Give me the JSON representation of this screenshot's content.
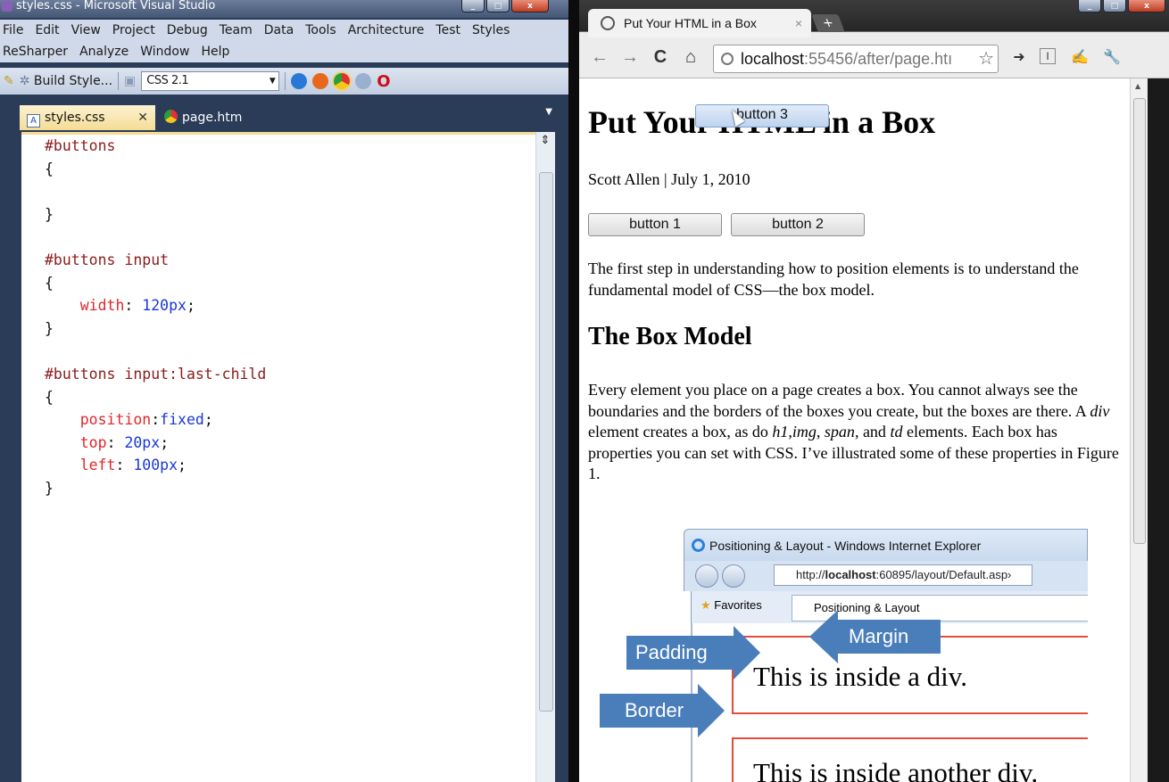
{
  "vs": {
    "title": "styles.css - Microsoft Visual Studio",
    "menu_row1": [
      "File",
      "Edit",
      "View",
      "Project",
      "Debug",
      "Team",
      "Data",
      "Tools",
      "Architecture",
      "Test",
      "Styles"
    ],
    "menu_row2": [
      "ReSharper",
      "Analyze",
      "Window",
      "Help"
    ],
    "toolbar": {
      "build_style": "Build Style...",
      "css_version": "CSS 2.1"
    },
    "tabs": [
      {
        "label": "styles.css"
      },
      {
        "label": "page.htm"
      }
    ],
    "code_lines": [
      [
        {
          "t": "#buttons",
          "c": "sel"
        }
      ],
      [
        {
          "t": "{",
          "c": ""
        }
      ],
      [],
      [
        {
          "t": "}",
          "c": ""
        }
      ],
      [],
      [
        {
          "t": "#buttons input",
          "c": "sel"
        }
      ],
      [
        {
          "t": "{",
          "c": ""
        }
      ],
      [
        {
          "t": "    ",
          "c": ""
        },
        {
          "t": "width",
          "c": "prop"
        },
        {
          "t": ": ",
          "c": ""
        },
        {
          "t": "120px",
          "c": "val"
        },
        {
          "t": ";",
          "c": ""
        }
      ],
      [
        {
          "t": "}",
          "c": ""
        }
      ],
      [],
      [
        {
          "t": "#buttons input:last-child",
          "c": "sel"
        }
      ],
      [
        {
          "t": "{",
          "c": ""
        }
      ],
      [
        {
          "t": "    ",
          "c": ""
        },
        {
          "t": "position",
          "c": "prop"
        },
        {
          "t": ":",
          "c": ""
        },
        {
          "t": "fixed",
          "c": "val"
        },
        {
          "t": ";",
          "c": ""
        }
      ],
      [
        {
          "t": "    ",
          "c": ""
        },
        {
          "t": "top",
          "c": "prop"
        },
        {
          "t": ": ",
          "c": ""
        },
        {
          "t": "20px",
          "c": "val"
        },
        {
          "t": ";",
          "c": ""
        }
      ],
      [
        {
          "t": "    ",
          "c": ""
        },
        {
          "t": "left",
          "c": "prop"
        },
        {
          "t": ": ",
          "c": ""
        },
        {
          "t": "100px",
          "c": "val"
        },
        {
          "t": ";",
          "c": ""
        }
      ],
      [
        {
          "t": "}",
          "c": ""
        }
      ]
    ]
  },
  "browser": {
    "tab_title": "Put Your HTML in a Box",
    "url_host": "localhost",
    "url_rest": ":55456/after/page.htı"
  },
  "page": {
    "heading": "Put Your HTML in a Box",
    "button3": "button 3",
    "byline": "Scott Allen | July 1, 2010",
    "button1": "button 1",
    "button2": "button 2",
    "intro": "The first step in understanding how to position elements is to understand the fundamental model of CSS—the box model.",
    "h2": "The Box Model",
    "body_html": "Every element you place on a page creates a box. You cannot always see the boundaries and the borders of the boxes you create, but the boxes are there. A <i>div</i> element creates a box, as do <i>h1</i>,<i>img</i>, <i>span</i>, and <i>td</i> elements. Each box has properties you can set with CSS. I’ve illustrated some of these properties in Figure 1."
  },
  "figure": {
    "title": "Positioning & Layout - Windows Internet Explorer",
    "url": "http://localhost:60895/layout/Default.asp›",
    "url_plain_prefix": "http://",
    "url_bold": "localhost",
    "url_suffix": ":60895/layout/Default.asp›",
    "favorites": "Favorites",
    "tab": "Positioning & Layout",
    "div1": "This is inside a div.",
    "div2": "This is inside another div.",
    "padding": "Padding",
    "margin": "Margin",
    "border": "Border"
  }
}
